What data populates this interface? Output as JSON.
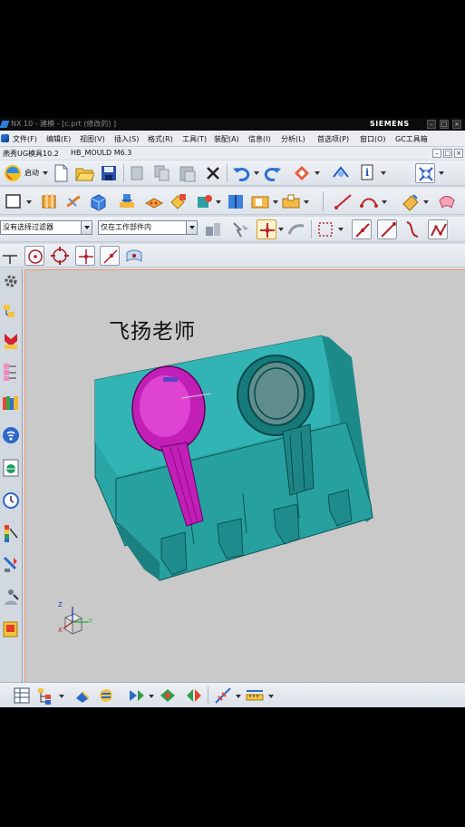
{
  "window": {
    "title": "NX 10 - 建模 - [c.prt  (修改的) ]",
    "brand": "SIEMENS",
    "controls": [
      "–",
      "□",
      "×"
    ]
  },
  "menubar": {
    "items": [
      "文件(F)",
      "编辑(E)",
      "视图(V)",
      "插入(S)",
      "格式(R)",
      "工具(T)",
      "装配(A)",
      "信息(I)",
      "分析(L)",
      "首选项(P)",
      "窗口(O)",
      "GC工具箱"
    ],
    "mini_controls": [
      "–",
      "□",
      "×"
    ]
  },
  "pluginbar": {
    "items": [
      "燕秀UG模具10.2",
      "HB_MOULD M6.3"
    ]
  },
  "toolbar_main": {
    "start_label": "启动",
    "icons": [
      "nx-start-icon",
      "new-file-icon",
      "open-folder-icon",
      "save-icon",
      "cut-icon",
      "copy-icon",
      "paste-icon",
      "delete-icon",
      "undo-icon",
      "redo-icon",
      "command-finder-icon",
      "view-orient-icon",
      "info-icon",
      "fit-view-icon"
    ]
  },
  "toolbar_feature": {
    "icons": [
      "sketch-icon",
      "extrude-icon",
      "revolve-icon",
      "block-icon",
      "mould-tool-icon",
      "cavity-icon",
      "component-icon",
      "assembly-icon",
      "book-icon",
      "pocket-icon",
      "boss-icon",
      "curve-line-icon",
      "arc-icon",
      "face-icon",
      "surface-icon"
    ]
  },
  "selection_bar": {
    "filter_value": "没有选择过滤器",
    "scope_value": "仅在工作部件内",
    "icons": [
      "snap-icon",
      "selection-arrow-icon",
      "point-snap-icon",
      "curve-rule-icon",
      "rectangle-select-icon",
      "line-snap-icon",
      "midpoint-snap-icon",
      "curve-snap-icon",
      "polyline-snap-icon"
    ]
  },
  "snap_bar": {
    "icons": [
      "axis-icon",
      "circle-center-icon",
      "quadrant-icon",
      "intersection-icon",
      "endpoint-icon",
      "face-point-icon"
    ]
  },
  "resource_bar": {
    "icons": [
      "settings-gear-icon",
      "assembly-navigator-icon",
      "constraint-navigator-icon",
      "part-navigator-icon",
      "reuse-library-icon",
      "wifi-icon",
      "web-browser-icon",
      "history-icon",
      "palette-icon",
      "process-icon",
      "role-icon",
      "system-icon"
    ]
  },
  "graphics": {
    "watermark": "飞扬老师",
    "triad": {
      "x": "X",
      "y": "Y",
      "z": "Z"
    }
  },
  "bottom_toolbar": {
    "icons": [
      "table-icon",
      "assembly-tree-icon",
      "move-icon",
      "constraint-icon",
      "display-icon",
      "render-icon",
      "mirror-icon",
      "measure-icon",
      "ruler-icon"
    ]
  },
  "colors": {
    "mold_base": "#2aa5a5",
    "highlight_part": "#d021c6",
    "viewport_bg": "#c9c9c9",
    "selection_border": "#f09a6a"
  }
}
